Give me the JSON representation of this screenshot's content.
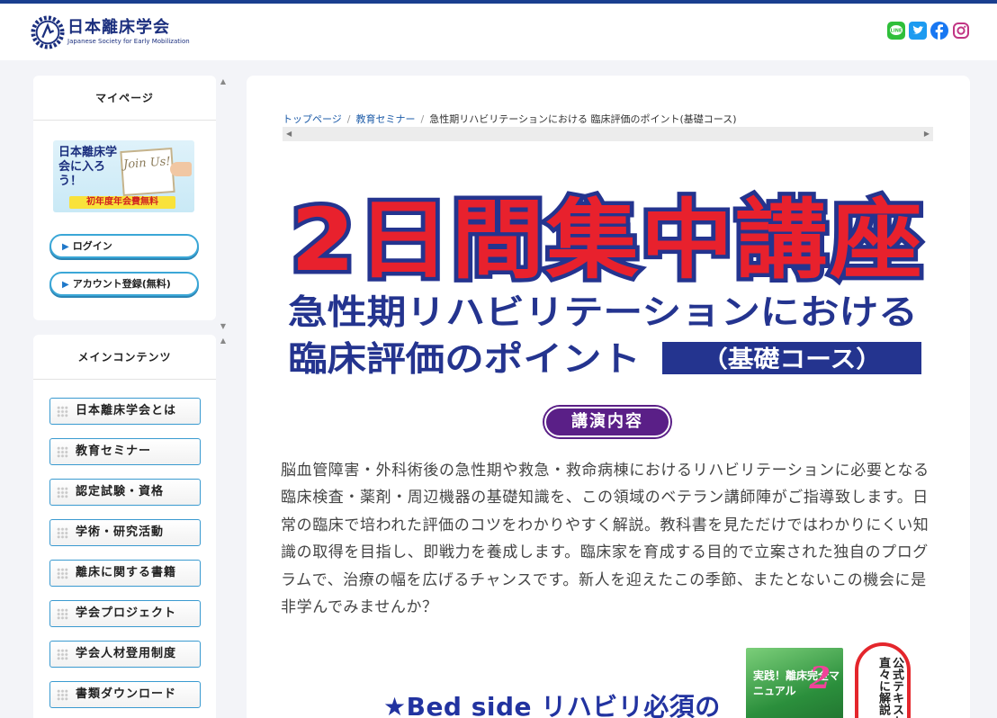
{
  "header": {
    "logo_jp": "日本離床学会",
    "logo_en": "Japanese Society for Early Mobilization",
    "social": [
      {
        "icon": "line-icon",
        "color": "#2fbf3a"
      },
      {
        "icon": "twitter-icon",
        "color": "#1d9bf0"
      },
      {
        "icon": "facebook-icon",
        "color": "#1877f2"
      },
      {
        "icon": "instagram-icon",
        "color": "#c13584"
      }
    ]
  },
  "sidebar": {
    "mypage_title": "マイページ",
    "banner": {
      "text": "日本離床学会に入ろう！",
      "board": "Join Us!",
      "band": "初年度年会費無料"
    },
    "login_label": "ログイン",
    "register_label": "アカウント登録(無料)",
    "main_title": "メインコンテンツ",
    "items": [
      {
        "label": "日本離床学会とは"
      },
      {
        "label": "教育セミナー"
      },
      {
        "label": "認定試験・資格"
      },
      {
        "label": "学術・研究活動"
      },
      {
        "label": "離床に関する書籍"
      },
      {
        "label": "学会プロジェクト"
      },
      {
        "label": "学会人材登用制度"
      },
      {
        "label": "書類ダウンロード"
      }
    ]
  },
  "main": {
    "breadcrumb": {
      "home": "トップページ",
      "section": "教育セミナー",
      "current": "急性期リハビリテーションにおける 臨床評価のポイント(基礎コース)"
    },
    "hero": {
      "headline": "2日間集中講座",
      "line1": "急性期リハビリテーションにおける",
      "line2": "臨床評価のポイント",
      "course": "（基礎コース）",
      "red": "#e8212d",
      "navy": "#24348f"
    },
    "section_badge": "講演内容",
    "description": "脳血管障害・外科術後の急性期や救急・救命病棟におけるリハビリテーションに必要となる臨床検査・薬剤・周辺機器の基礎知識を、この領域のベテラン講師陣がご指導致します。日常の臨床で培われた評価のコツをわかりやすく解説。教科書を見ただけではわかりにくい知識の取得を目指し、即戦力を養成します。臨床家を育成する目的で立案された独自のプログラムで、治療の幅を広げるチャンスです。新人を迎えたこの季節、またとないこの機会に是非学んでみませんか？",
    "subtitle": "★Bed side リハビリ必須の",
    "book": {
      "title": "実践！離床完全マニュアル",
      "num": "2"
    },
    "callout": "公式テキスト直々に解説"
  }
}
